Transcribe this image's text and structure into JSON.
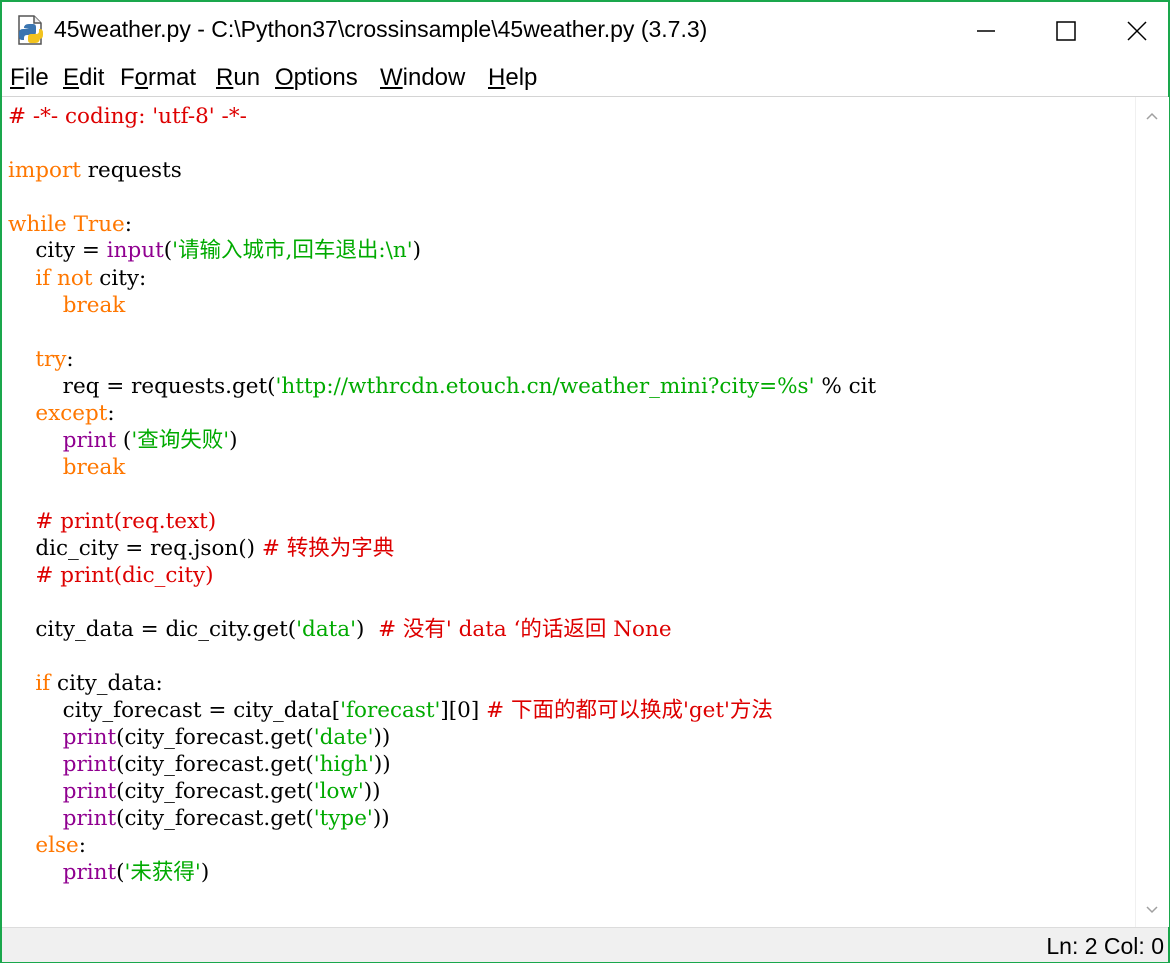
{
  "window": {
    "title": "45weather.py - C:\\Python37\\crossinsample\\45weather.py (3.7.3)",
    "border_color": "#1aa74c",
    "icons": {
      "app": "python-file-icon",
      "minimize": "minimize-icon",
      "maximize": "maximize-icon",
      "close": "close-icon"
    }
  },
  "menu": [
    {
      "key": "F",
      "rest": "ile"
    },
    {
      "key": "E",
      "rest": "dit"
    },
    {
      "pre": "F",
      "key": "o",
      "rest": "rmat"
    },
    {
      "key": "R",
      "rest": "un"
    },
    {
      "key": "O",
      "rest": "ptions"
    },
    {
      "key": "W",
      "rest": "indow"
    },
    {
      "key": "H",
      "rest": "elp"
    }
  ],
  "syntax_colors": {
    "keyword": "#ff7700",
    "builtin": "#900090",
    "string": "#00aa00",
    "comment": "#dd0000",
    "default": "#000000"
  },
  "code_lines": [
    [
      [
        "cm",
        "# -*- coding: 'utf-8' -*-"
      ]
    ],
    [],
    [
      [
        "kw",
        "import"
      ],
      [
        "df",
        " requests"
      ]
    ],
    [],
    [
      [
        "kw",
        "while"
      ],
      [
        "df",
        " "
      ],
      [
        "kw",
        "True"
      ],
      [
        "df",
        ":"
      ]
    ],
    [
      [
        "df",
        "    city = "
      ],
      [
        "bi",
        "input"
      ],
      [
        "df",
        "("
      ],
      [
        "str",
        "'请输入城市,回车退出:\\n'"
      ],
      [
        "df",
        ")"
      ]
    ],
    [
      [
        "df",
        "    "
      ],
      [
        "kw",
        "if"
      ],
      [
        "df",
        " "
      ],
      [
        "kw",
        "not"
      ],
      [
        "df",
        " city:"
      ]
    ],
    [
      [
        "df",
        "        "
      ],
      [
        "kw",
        "break"
      ]
    ],
    [],
    [
      [
        "df",
        "    "
      ],
      [
        "kw",
        "try"
      ],
      [
        "df",
        ":"
      ]
    ],
    [
      [
        "df",
        "        req = requests.get("
      ],
      [
        "str",
        "'http://wthrcdn.etouch.cn/weather_mini?city=%s'"
      ],
      [
        "df",
        " % cit"
      ]
    ],
    [
      [
        "df",
        "    "
      ],
      [
        "kw",
        "except"
      ],
      [
        "df",
        ":"
      ]
    ],
    [
      [
        "df",
        "        "
      ],
      [
        "bi",
        "print"
      ],
      [
        "df",
        " ("
      ],
      [
        "str",
        "'查询失败'"
      ],
      [
        "df",
        ")"
      ]
    ],
    [
      [
        "df",
        "        "
      ],
      [
        "kw",
        "break"
      ]
    ],
    [],
    [
      [
        "df",
        "    "
      ],
      [
        "cm",
        "# print(req.text)"
      ]
    ],
    [
      [
        "df",
        "    dic_city = req.json() "
      ],
      [
        "cm",
        "# 转换为字典"
      ]
    ],
    [
      [
        "df",
        "    "
      ],
      [
        "cm",
        "# print(dic_city)"
      ]
    ],
    [],
    [
      [
        "df",
        "    city_data = dic_city.get("
      ],
      [
        "str",
        "'data'"
      ],
      [
        "df",
        ")  "
      ],
      [
        "cm",
        "# 没有' data ‘的话返回 None"
      ]
    ],
    [],
    [
      [
        "df",
        "    "
      ],
      [
        "kw",
        "if"
      ],
      [
        "df",
        " city_data:"
      ]
    ],
    [
      [
        "df",
        "        city_forecast = city_data["
      ],
      [
        "str",
        "'forecast'"
      ],
      [
        "df",
        "][0] "
      ],
      [
        "cm",
        "# 下面的都可以换成'get'方法"
      ]
    ],
    [
      [
        "df",
        "        "
      ],
      [
        "bi",
        "print"
      ],
      [
        "df",
        "(city_forecast.get("
      ],
      [
        "str",
        "'date'"
      ],
      [
        "df",
        "))"
      ]
    ],
    [
      [
        "df",
        "        "
      ],
      [
        "bi",
        "print"
      ],
      [
        "df",
        "(city_forecast.get("
      ],
      [
        "str",
        "'high'"
      ],
      [
        "df",
        "))"
      ]
    ],
    [
      [
        "df",
        "        "
      ],
      [
        "bi",
        "print"
      ],
      [
        "df",
        "(city_forecast.get("
      ],
      [
        "str",
        "'low'"
      ],
      [
        "df",
        "))"
      ]
    ],
    [
      [
        "df",
        "        "
      ],
      [
        "bi",
        "print"
      ],
      [
        "df",
        "(city_forecast.get("
      ],
      [
        "str",
        "'type'"
      ],
      [
        "df",
        "))"
      ]
    ],
    [
      [
        "df",
        "    "
      ],
      [
        "kw",
        "else"
      ],
      [
        "df",
        ":"
      ]
    ],
    [
      [
        "df",
        "        "
      ],
      [
        "bi",
        "print"
      ],
      [
        "df",
        "("
      ],
      [
        "str",
        "'未获得'"
      ],
      [
        "df",
        ")"
      ]
    ]
  ],
  "scrollbar": {
    "up_icon": "scroll-up-arrow-icon",
    "down_icon": "scroll-down-arrow-icon"
  },
  "status": {
    "text": "Ln: 2  Col: 0"
  }
}
